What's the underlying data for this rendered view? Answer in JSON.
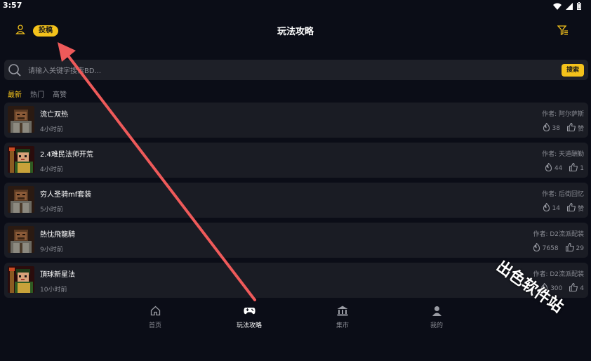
{
  "status_bar": {
    "time": "3:57"
  },
  "header": {
    "submit_label": "投稿",
    "title": "玩法攻略"
  },
  "search": {
    "placeholder": "请输入关键字搜索BD...",
    "button_label": "搜索"
  },
  "tabs": [
    {
      "label": "最新",
      "active": true
    },
    {
      "label": "热门",
      "active": false
    },
    {
      "label": "高赞",
      "active": false
    }
  ],
  "posts": [
    {
      "title": "流亡双热",
      "time": "4小时前",
      "author": "作者: 阿尔萨斯",
      "heat": "38",
      "likes": "赞",
      "avatar": "barbarian"
    },
    {
      "title": "2.4难民法师开荒",
      "time": "4小时前",
      "author": "作者: 天道酬勤",
      "heat": "44",
      "likes": "1",
      "avatar": "sorceress"
    },
    {
      "title": "穷人圣骑mf套装",
      "time": "5小时前",
      "author": "作者: 后街回忆",
      "heat": "14",
      "likes": "赞",
      "avatar": "barbarian"
    },
    {
      "title": "熱忱飛龍騎",
      "time": "9小时前",
      "author": "作者: D2流派配装",
      "heat": "7658",
      "likes": "29",
      "avatar": "barbarian"
    },
    {
      "title": "頂球新星法",
      "time": "10小时前",
      "author": "作者: D2流派配装",
      "heat": "300",
      "likes": "4",
      "avatar": "sorceress"
    }
  ],
  "bottom_nav": [
    {
      "label": "首页",
      "icon": "home-icon",
      "active": false
    },
    {
      "label": "玩法攻略",
      "icon": "gamepad-icon",
      "active": true
    },
    {
      "label": "集市",
      "icon": "bank-icon",
      "active": false
    },
    {
      "label": "我的",
      "icon": "person-icon",
      "active": false
    }
  ],
  "watermark": "出色软件站",
  "colors": {
    "background": "#0b0d17",
    "card": "#1a1c24",
    "accent": "#f4c21b",
    "annotation": "#ee5a5a"
  }
}
